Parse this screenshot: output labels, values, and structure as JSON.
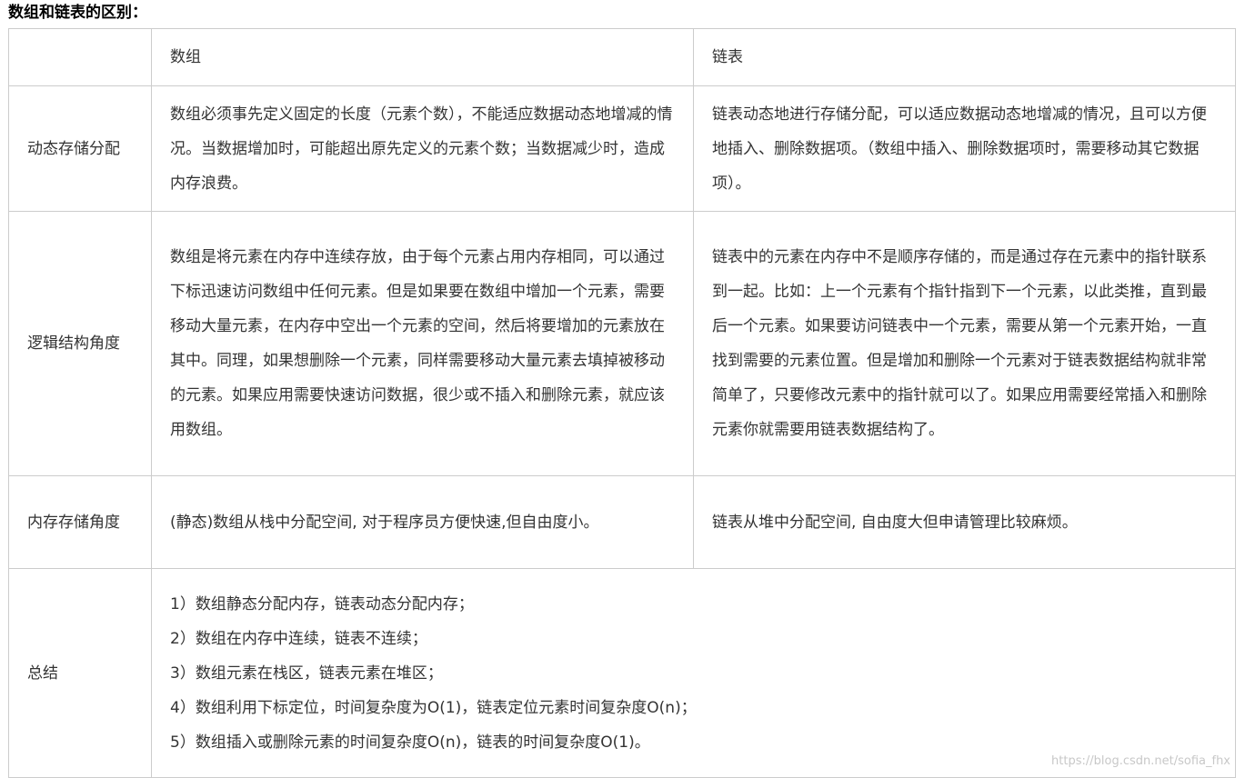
{
  "title": "数组和链表的区别：",
  "table": {
    "header": {
      "corner": "",
      "col_array": "数组",
      "col_list": "链表"
    },
    "rows": [
      {
        "label": "动态存储分配",
        "array": "数组必须事先定义固定的长度（元素个数），不能适应数据动态地增减的情况。当数据增加时，可能超出原先定义的元素个数；当数据减少时，造成内存浪费。",
        "list": "链表动态地进行存储分配，可以适应数据动态地增减的情况，且可以方便地插入、删除数据项。（数组中插入、删除数据项时，需要移动其它数据项）。"
      },
      {
        "label": "逻辑结构角度",
        "array": "数组是将元素在内存中连续存放，由于每个元素占用内存相同，可以通过下标迅速访问数组中任何元素。但是如果要在数组中增加一个元素，需要移动大量元素，在内存中空出一个元素的空间，然后将要增加的元素放在其中。同理，如果想删除一个元素，同样需要移动大量元素去填掉被移动的元素。如果应用需要快速访问数据，很少或不插入和删除元素，就应该用数组。",
        "list": "链表中的元素在内存中不是顺序存储的，而是通过存在元素中的指针联系到一起。比如：上一个元素有个指针指到下一个元素，以此类推，直到最后一个元素。如果要访问链表中一个元素，需要从第一个元素开始，一直找到需要的元素位置。但是增加和删除一个元素对于链表数据结构就非常简单了，只要修改元素中的指针就可以了。如果应用需要经常插入和删除元素你就需要用链表数据结构了。"
      },
      {
        "label": "内存存储角度",
        "array": "(静态)数组从栈中分配空间, 对于程序员方便快速,但自由度小。",
        "list": "链表从堆中分配空间, 自由度大但申请管理比较麻烦。"
      }
    ],
    "summary": {
      "label": "总结",
      "lines": [
        "1）数组静态分配内存，链表动态分配内存；",
        "2）数组在内存中连续，链表不连续；",
        "3）数组元素在栈区，链表元素在堆区；",
        "4）数组利用下标定位，时间复杂度为O(1)，链表定位元素时间复杂度O(n)；",
        "5）数组插入或删除元素的时间复杂度O(n)，链表的时间复杂度O(1)。"
      ]
    }
  },
  "watermark": "https://blog.csdn.net/sofia_fhx"
}
